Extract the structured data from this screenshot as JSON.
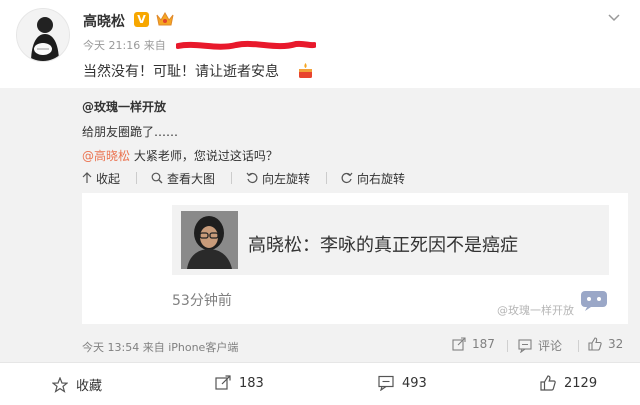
{
  "post": {
    "author": "高晓松",
    "time_prefix": "今天 21:16 来自",
    "text": "当然没有！可耻！请让逝者安息",
    "verified_badge": "V"
  },
  "repost": {
    "author": "@玫瑰一样开放",
    "text": "给朋友圈跪了……",
    "mention": "@高晓松",
    "mention_rest": " 大紧老师，您说过这话吗？",
    "tools": [
      {
        "icon": "collapse-icon",
        "label": "收起"
      },
      {
        "icon": "search-icon",
        "label": "查看大图"
      },
      {
        "icon": "rotate-left-icon",
        "label": "向左旋转"
      },
      {
        "icon": "rotate-right-icon",
        "label": "向右旋转"
      }
    ],
    "card": {
      "title": "高晓松：李咏的真正死因不是癌症",
      "time": "53分钟前",
      "watermark": "@玫瑰一样开放"
    },
    "footer_meta": "今天 13:54 来自 iPhone客户端",
    "stats": {
      "reposts": "187",
      "comments_label": "评论",
      "likes": "32"
    }
  },
  "actions": {
    "favorite": "收藏",
    "reposts": "183",
    "comments": "493",
    "likes": "2129"
  },
  "colors": {
    "mention": "#eb7350",
    "badge": "#f7a700",
    "repost_bg": "#f2f2f2"
  }
}
